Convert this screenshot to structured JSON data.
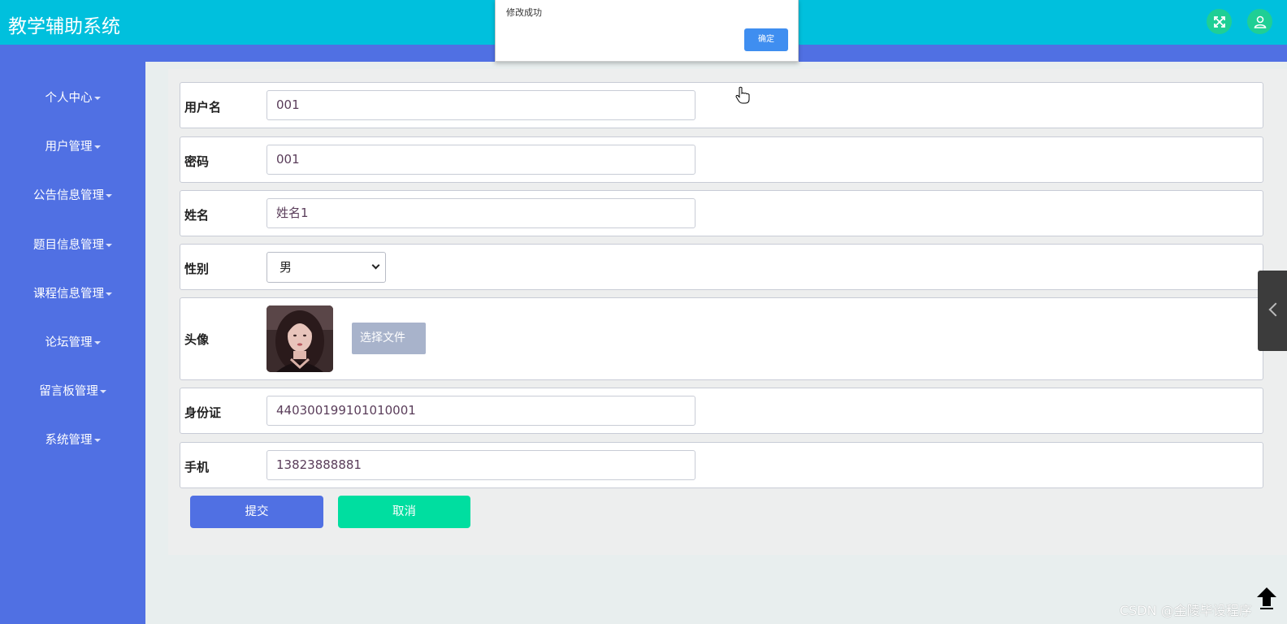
{
  "app": {
    "title": "教学辅助系统"
  },
  "header": {
    "fullscreen_icon": "fullscreen-icon",
    "user_icon": "user-icon"
  },
  "sidebar": {
    "items": [
      {
        "label": "个人中心"
      },
      {
        "label": "用户管理"
      },
      {
        "label": "公告信息管理"
      },
      {
        "label": "题目信息管理"
      },
      {
        "label": "课程信息管理"
      },
      {
        "label": "论坛管理"
      },
      {
        "label": "留言板管理"
      },
      {
        "label": "系统管理"
      }
    ]
  },
  "form": {
    "username": {
      "label": "用户名",
      "value": "001"
    },
    "password": {
      "label": "密码",
      "value": "001"
    },
    "name": {
      "label": "姓名",
      "value": "姓名1"
    },
    "gender": {
      "label": "性别",
      "value": "男"
    },
    "avatar": {
      "label": "头像",
      "file_button": "选择文件"
    },
    "id_card": {
      "label": "身份证",
      "value": "440300199101010001"
    },
    "phone": {
      "label": "手机",
      "value": "13823888881"
    },
    "submit_label": "提交",
    "cancel_label": "取消"
  },
  "alert": {
    "message": "修改成功",
    "confirm_label": "确定"
  },
  "watermark": "CSDN @金陵毕设程序",
  "colors": {
    "topbar": "#00c0dd",
    "sidebar": "#5070e3",
    "submit": "#5070e3",
    "cancel": "#00dea0",
    "icon_bg": "#1fcf95"
  }
}
